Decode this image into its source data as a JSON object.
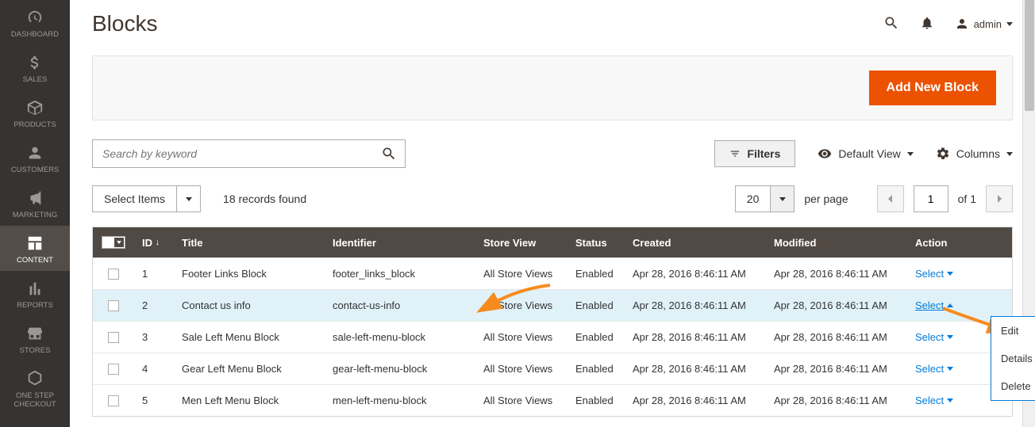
{
  "page_title": "Blocks",
  "admin_user": "admin",
  "primary_button": "Add New Block",
  "search_placeholder": "Search by keyword",
  "filters_label": "Filters",
  "default_view_label": "Default View",
  "columns_label": "Columns",
  "select_items_label": "Select Items",
  "records_found": "18 records found",
  "per_page_value": "20",
  "per_page_label": "per page",
  "page_number": "1",
  "of_label": "of 1",
  "sidebar": [
    {
      "label": "DASHBOARD",
      "icon": "gauge",
      "active": false
    },
    {
      "label": "SALES",
      "icon": "dollar",
      "active": false
    },
    {
      "label": "PRODUCTS",
      "icon": "box",
      "active": false
    },
    {
      "label": "CUSTOMERS",
      "icon": "person",
      "active": false
    },
    {
      "label": "MARKETING",
      "icon": "megaphone",
      "active": false
    },
    {
      "label": "CONTENT",
      "icon": "layout",
      "active": true
    },
    {
      "label": "REPORTS",
      "icon": "bars",
      "active": false
    },
    {
      "label": "STORES",
      "icon": "storefront",
      "active": false
    },
    {
      "label": "ONE STEP CHECKOUT",
      "icon": "hex",
      "active": false
    }
  ],
  "columns": {
    "check": "",
    "id": "ID",
    "title": "Title",
    "identifier": "Identifier",
    "store": "Store View",
    "status": "Status",
    "created": "Created",
    "modified": "Modified",
    "action": "Action"
  },
  "rows": [
    {
      "id": "1",
      "title": "Footer Links Block",
      "identifier": "footer_links_block",
      "store": "All Store Views",
      "status": "Enabled",
      "created": "Apr 28, 2016 8:46:11 AM",
      "modified": "Apr 28, 2016 8:46:11 AM",
      "action": "Select",
      "open": false,
      "highlight": false
    },
    {
      "id": "2",
      "title": "Contact us info",
      "identifier": "contact-us-info",
      "store": "All Store Views",
      "status": "Enabled",
      "created": "Apr 28, 2016 8:46:11 AM",
      "modified": "Apr 28, 2016 8:46:11 AM",
      "action": "Select",
      "open": true,
      "highlight": true
    },
    {
      "id": "3",
      "title": "Sale Left Menu Block",
      "identifier": "sale-left-menu-block",
      "store": "All Store Views",
      "status": "Enabled",
      "created": "Apr 28, 2016 8:46:11 AM",
      "modified": "Apr 28, 2016 8:46:11 AM",
      "action": "Select",
      "open": false,
      "highlight": false
    },
    {
      "id": "4",
      "title": "Gear Left Menu Block",
      "identifier": "gear-left-menu-block",
      "store": "All Store Views",
      "status": "Enabled",
      "created": "Apr 28, 2016 8:46:11 AM",
      "modified": "Apr 28, 2016 8:46:11 AM",
      "action": "Select",
      "open": false,
      "highlight": false
    },
    {
      "id": "5",
      "title": "Men Left Menu Block",
      "identifier": "men-left-menu-block",
      "store": "All Store Views",
      "status": "Enabled",
      "created": "Apr 28, 2016 8:46:11 AM",
      "modified": "Apr 28, 2016 8:46:11 AM",
      "action": "Select",
      "open": false,
      "highlight": false
    }
  ],
  "action_menu": [
    "Edit",
    "Details",
    "Delete"
  ]
}
